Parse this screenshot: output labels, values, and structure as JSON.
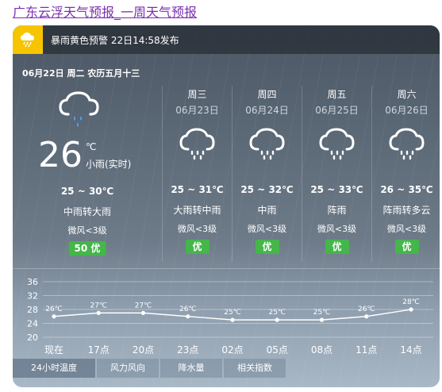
{
  "page_title": "广东云浮天气预报_一周天气预报",
  "alert": {
    "icon": "rainstorm-warning-icon",
    "text": "暴雨黄色预警 22日14:58发布",
    "color": "#f7c400"
  },
  "date_line": "06月22日 周二 农历五月十三",
  "today": {
    "icon": "cloud-rain-icon",
    "temp": "26",
    "unit": "℃",
    "desc": "小雨(实时)",
    "range": "25 ~ 30℃",
    "weather": "中雨转大雨",
    "wind": "微风<3级",
    "aqi": "50  优"
  },
  "days": [
    {
      "name": "周三",
      "date": "06月23日",
      "icon": "cloud-rain-icon",
      "range": "25 ~ 31℃",
      "weather": "大雨转中雨",
      "wind": "微风<3级",
      "aqi": "优"
    },
    {
      "name": "周四",
      "date": "06月24日",
      "icon": "cloud-rain-icon",
      "range": "25 ~ 32℃",
      "weather": "中雨",
      "wind": "微风<3级",
      "aqi": "优"
    },
    {
      "name": "周五",
      "date": "06月25日",
      "icon": "cloud-rain-icon",
      "range": "25 ~ 33℃",
      "weather": "阵雨",
      "wind": "微风<3级",
      "aqi": "优"
    },
    {
      "name": "周六",
      "date": "06月26日",
      "icon": "cloud-rain-icon",
      "range": "26 ~ 35℃",
      "weather": "阵雨转多云",
      "wind": "微风<3级",
      "aqi": "优"
    }
  ],
  "colors": {
    "aqi_good": "#44b64a",
    "alert": "#f7c400"
  },
  "chart_data": {
    "type": "line",
    "categories": [
      "现在",
      "17点",
      "20点",
      "23点",
      "02点",
      "05点",
      "08点",
      "11点",
      "14点"
    ],
    "values": [
      26,
      27,
      27,
      26,
      25,
      25,
      25,
      26,
      28
    ],
    "point_labels": [
      "26℃",
      "27℃",
      "27℃",
      "26℃",
      "25℃",
      "25℃",
      "25℃",
      "26℃",
      "28℃"
    ],
    "ylim": [
      20,
      36
    ],
    "yticks": [
      20,
      24,
      28,
      32,
      36
    ],
    "ytick_labels": [
      "20",
      "24",
      "28",
      "32",
      "36"
    ],
    "grid": true
  },
  "tabs": [
    "24小时温度",
    "风力风向",
    "降水量",
    "相关指数"
  ]
}
